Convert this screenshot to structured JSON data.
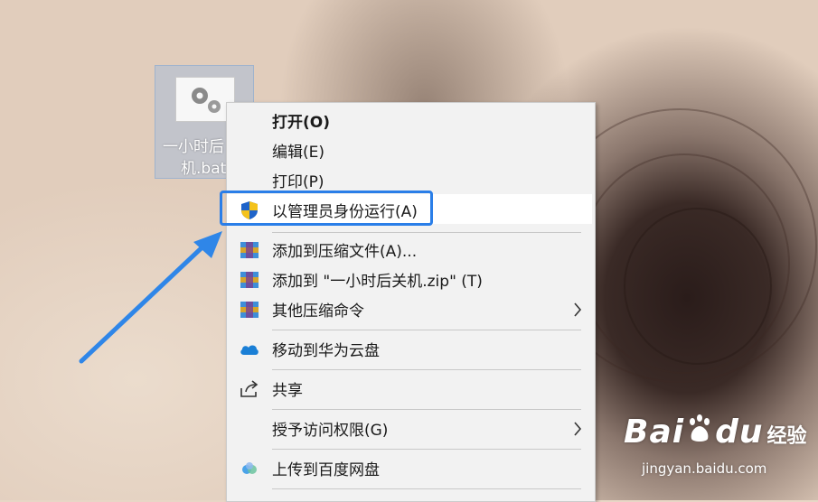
{
  "desktop_icon": {
    "label_line1": "一小时后",
    "label_line2": "机.bat"
  },
  "context_menu": {
    "items": [
      {
        "label": "打开(O)",
        "icon": "none"
      },
      {
        "label": "编辑(E)",
        "icon": "none"
      },
      {
        "label": "打印(P)",
        "icon": "none"
      },
      {
        "label": "以管理员身份运行(A)",
        "icon": "uac-shield-icon"
      },
      {
        "label": "添加到压缩文件(A)...",
        "icon": "winrar-icon"
      },
      {
        "label": "添加到 \"一小时后关机.zip\" (T)",
        "icon": "winrar-icon"
      },
      {
        "label": "其他压缩命令",
        "icon": "winrar-icon",
        "submenu": true
      },
      {
        "label": "移动到华为云盘",
        "icon": "huawei-cloud-icon"
      },
      {
        "label": "共享",
        "icon": "share-icon"
      },
      {
        "label": "授予访问权限(G)",
        "icon": "none",
        "submenu": true
      },
      {
        "label": "上传到百度网盘",
        "icon": "baidu-netdisk-icon"
      }
    ]
  },
  "watermark": {
    "logo": "Bai",
    "logo_tail": "du",
    "cn": "经验",
    "url": "jingyan.baidu.com"
  },
  "colors": {
    "highlight_border": "#2a7ee8",
    "arrow": "#2f86e8",
    "menu_bg": "#f2f2f2"
  }
}
